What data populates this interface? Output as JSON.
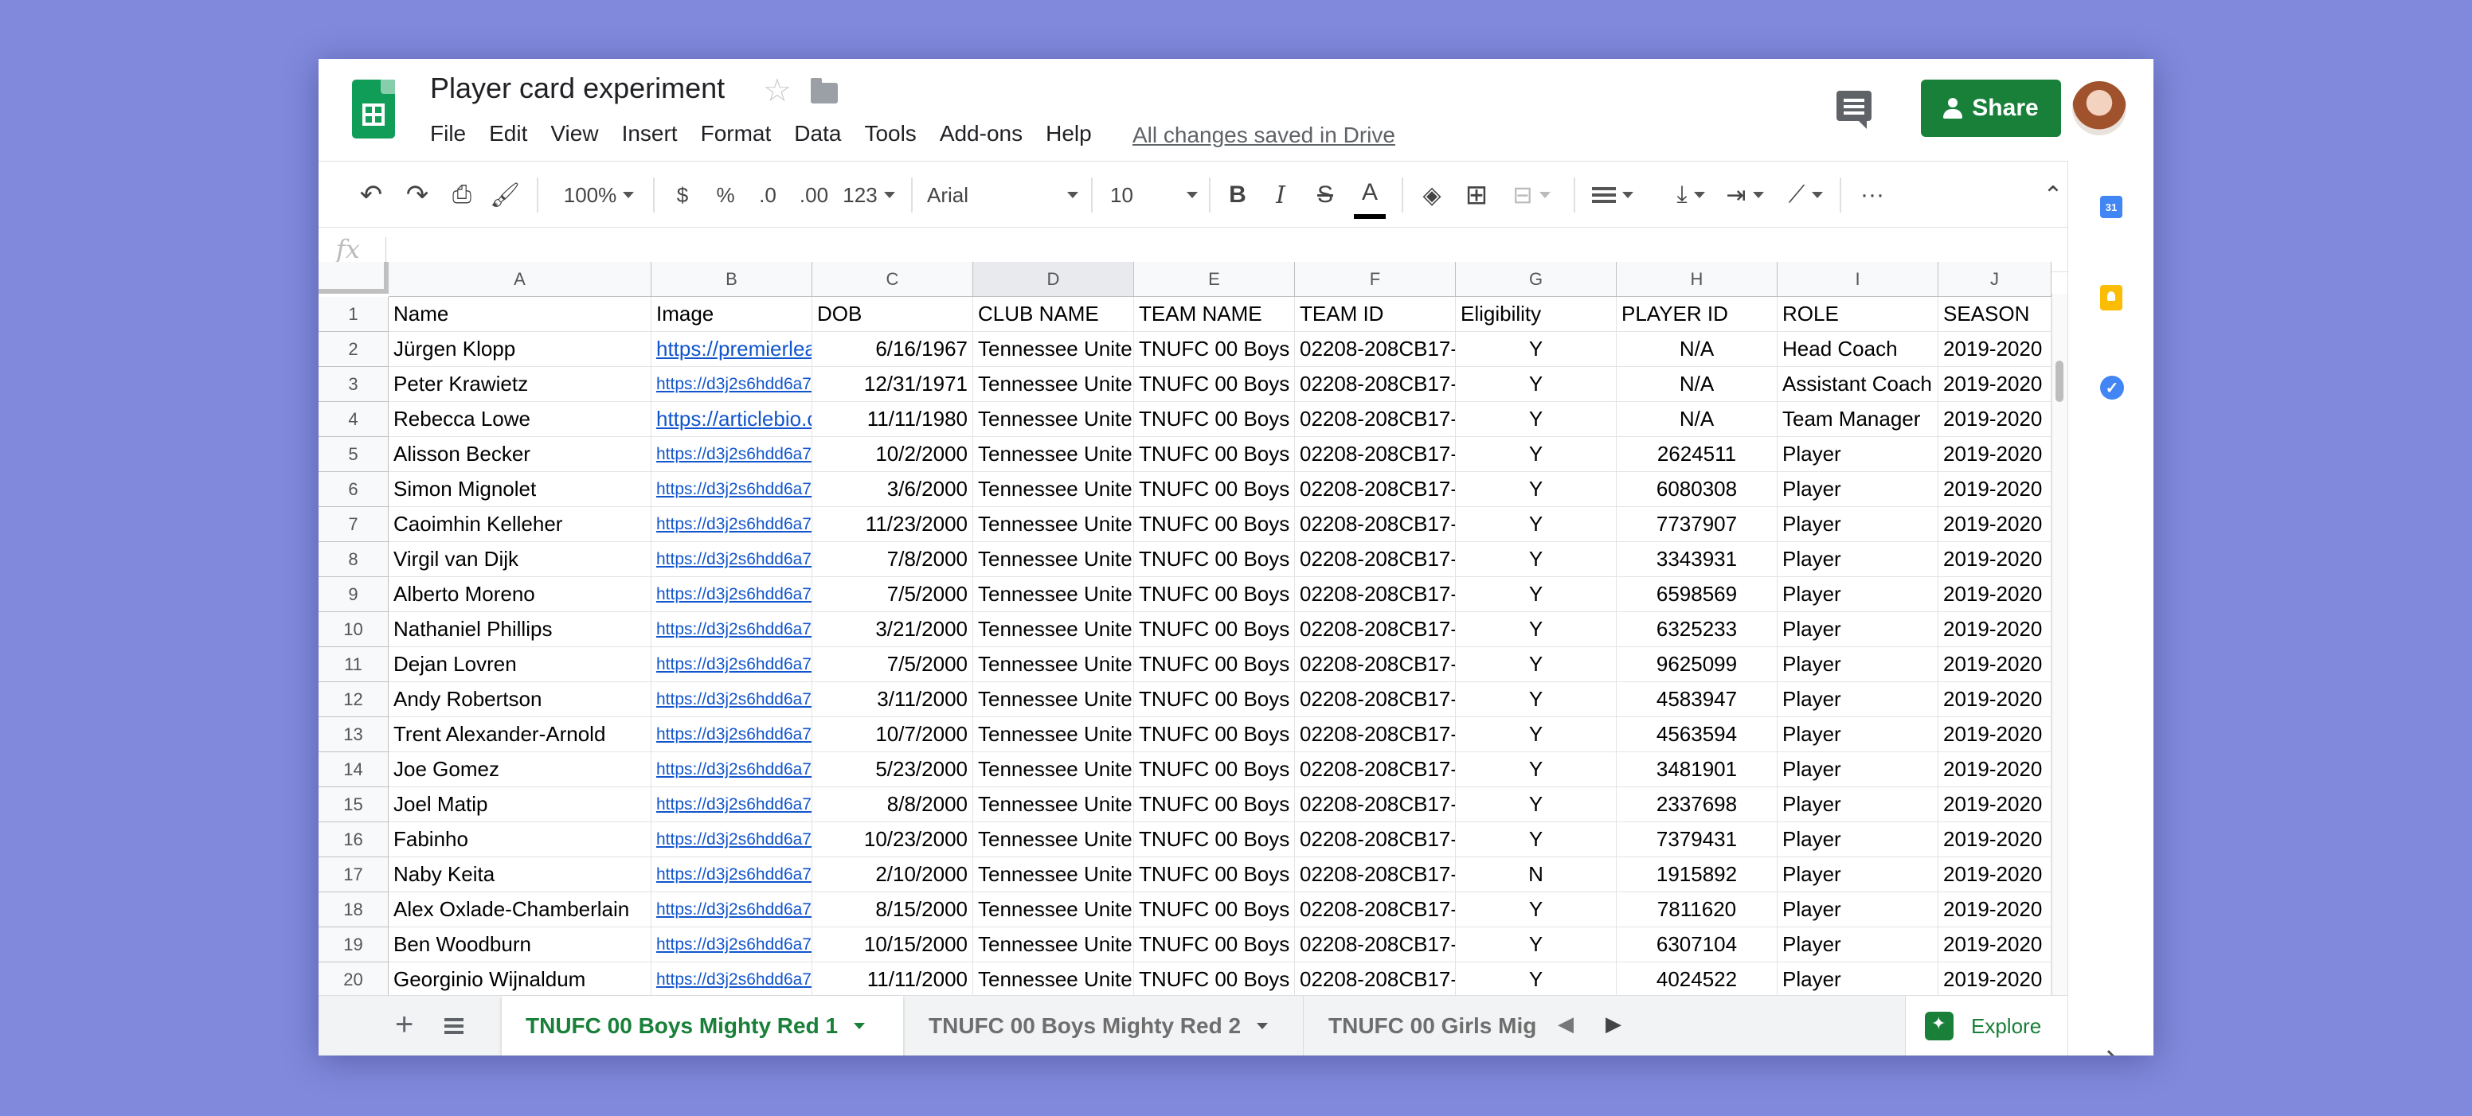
{
  "app": {
    "doc_title": "Player card experiment",
    "menus": [
      "File",
      "Edit",
      "View",
      "Insert",
      "Format",
      "Data",
      "Tools",
      "Add-ons",
      "Help"
    ],
    "saved_status": "All changes saved in Drive",
    "share_label": "Share"
  },
  "toolbar": {
    "zoom": "100%",
    "currency": "$",
    "percent": "%",
    "decrease_decimal": ".0",
    "increase_decimal": ".00",
    "more_formats": "123",
    "font": "Arial",
    "font_size": "10",
    "bold": "B",
    "italic": "I",
    "strike": "S",
    "text_color": "A",
    "more": "···"
  },
  "formula": {
    "fx": "fx",
    "value": ""
  },
  "grid": {
    "columns": [
      "A",
      "B",
      "C",
      "D",
      "E",
      "F",
      "G",
      "H",
      "I",
      "J"
    ],
    "row_numbers": [
      "1",
      "2",
      "3",
      "4",
      "5",
      "6",
      "7",
      "8",
      "9",
      "10",
      "11",
      "12",
      "13",
      "14",
      "15",
      "16",
      "17",
      "18",
      "19",
      "20"
    ],
    "header": [
      "Name",
      "Image",
      "DOB",
      "CLUB NAME",
      "TEAM NAME",
      "TEAM ID",
      "Eligibility",
      "PLAYER ID",
      "ROLE",
      "SEASON"
    ],
    "rows": [
      [
        "Jürgen Klopp",
        "https://premierlea",
        "6/16/1967",
        "Tennessee Unite",
        "TNUFC 00 Boys",
        "02208-208CB17-",
        "Y",
        "N/A",
        "Head Coach",
        "2019-2020"
      ],
      [
        "Peter Krawietz",
        "https://d3j2s6hdd6a7",
        "12/31/1971",
        "Tennessee Unite",
        "TNUFC 00 Boys",
        "02208-208CB17-",
        "Y",
        "N/A",
        "Assistant Coach",
        "2019-2020"
      ],
      [
        "Rebecca Lowe",
        "https://articlebio.c",
        "11/11/1980",
        "Tennessee Unite",
        "TNUFC 00 Boys",
        "02208-208CB17-",
        "Y",
        "N/A",
        "Team Manager",
        "2019-2020"
      ],
      [
        "Alisson Becker",
        "https://d3j2s6hdd6a7",
        "10/2/2000",
        "Tennessee Unite",
        "TNUFC 00 Boys",
        "02208-208CB17-",
        "Y",
        "2624511",
        "Player",
        "2019-2020"
      ],
      [
        "Simon Mignolet",
        "https://d3j2s6hdd6a7",
        "3/6/2000",
        "Tennessee Unite",
        "TNUFC 00 Boys",
        "02208-208CB17-",
        "Y",
        "6080308",
        "Player",
        "2019-2020"
      ],
      [
        "Caoimhin Kelleher",
        "https://d3j2s6hdd6a7",
        "11/23/2000",
        "Tennessee Unite",
        "TNUFC 00 Boys",
        "02208-208CB17-",
        "Y",
        "7737907",
        "Player",
        "2019-2020"
      ],
      [
        "Virgil van Dijk",
        "https://d3j2s6hdd6a7",
        "7/8/2000",
        "Tennessee Unite",
        "TNUFC 00 Boys",
        "02208-208CB17-",
        "Y",
        "3343931",
        "Player",
        "2019-2020"
      ],
      [
        "Alberto Moreno",
        "https://d3j2s6hdd6a7",
        "7/5/2000",
        "Tennessee Unite",
        "TNUFC 00 Boys",
        "02208-208CB17-",
        "Y",
        "6598569",
        "Player",
        "2019-2020"
      ],
      [
        "Nathaniel Phillips",
        "https://d3j2s6hdd6a7",
        "3/21/2000",
        "Tennessee Unite",
        "TNUFC 00 Boys",
        "02208-208CB17-",
        "Y",
        "6325233",
        "Player",
        "2019-2020"
      ],
      [
        "Dejan Lovren",
        "https://d3j2s6hdd6a7",
        "7/5/2000",
        "Tennessee Unite",
        "TNUFC 00 Boys",
        "02208-208CB17-",
        "Y",
        "9625099",
        "Player",
        "2019-2020"
      ],
      [
        "Andy Robertson",
        "https://d3j2s6hdd6a7",
        "3/11/2000",
        "Tennessee Unite",
        "TNUFC 00 Boys",
        "02208-208CB17-",
        "Y",
        "4583947",
        "Player",
        "2019-2020"
      ],
      [
        "Trent Alexander-Arnold",
        "https://d3j2s6hdd6a7",
        "10/7/2000",
        "Tennessee Unite",
        "TNUFC 00 Boys",
        "02208-208CB17-",
        "Y",
        "4563594",
        "Player",
        "2019-2020"
      ],
      [
        "Joe Gomez",
        "https://d3j2s6hdd6a7",
        "5/23/2000",
        "Tennessee Unite",
        "TNUFC 00 Boys",
        "02208-208CB17-",
        "Y",
        "3481901",
        "Player",
        "2019-2020"
      ],
      [
        "Joel Matip",
        "https://d3j2s6hdd6a7",
        "8/8/2000",
        "Tennessee Unite",
        "TNUFC 00 Boys",
        "02208-208CB17-",
        "Y",
        "2337698",
        "Player",
        "2019-2020"
      ],
      [
        "Fabinho",
        "https://d3j2s6hdd6a7",
        "10/23/2000",
        "Tennessee Unite",
        "TNUFC 00 Boys",
        "02208-208CB17-",
        "Y",
        "7379431",
        "Player",
        "2019-2020"
      ],
      [
        "Naby Keita",
        "https://d3j2s6hdd6a7",
        "2/10/2000",
        "Tennessee Unite",
        "TNUFC 00 Boys",
        "02208-208CB17-",
        "N",
        "1915892",
        "Player",
        "2019-2020"
      ],
      [
        "Alex Oxlade-Chamberlain",
        "https://d3j2s6hdd6a7",
        "8/15/2000",
        "Tennessee Unite",
        "TNUFC 00 Boys",
        "02208-208CB17-",
        "Y",
        "7811620",
        "Player",
        "2019-2020"
      ],
      [
        "Ben Woodburn",
        "https://d3j2s6hdd6a7",
        "10/15/2000",
        "Tennessee Unite",
        "TNUFC 00 Boys",
        "02208-208CB17-",
        "Y",
        "6307104",
        "Player",
        "2019-2020"
      ],
      [
        "Georginio Wijnaldum",
        "https://d3j2s6hdd6a7",
        "11/11/2000",
        "Tennessee Unite",
        "TNUFC 00 Boys",
        "02208-208CB17-",
        "Y",
        "4024522",
        "Player",
        "2019-2020"
      ]
    ]
  },
  "sheets": {
    "tabs": [
      "TNUFC 00 Boys Mighty Red 1",
      "TNUFC 00 Boys Mighty Red 2",
      "TNUFC 00 Girls Mig"
    ],
    "active_index": 0,
    "explore_label": "Explore"
  },
  "side_panel": {
    "calendar_day": "31"
  },
  "colors": {
    "brand_green": "#188038",
    "background": "#8089dc",
    "link": "#1155cc"
  },
  "icons": [
    "undo-icon",
    "redo-icon",
    "print-icon",
    "paint-format-icon",
    "bold-icon",
    "italic-icon",
    "strikethrough-icon",
    "text-color-icon",
    "fill-color-icon",
    "borders-icon",
    "merge-cells-icon",
    "align-icon",
    "valign-icon",
    "text-wrap-icon",
    "text-rotation-icon",
    "more-icon",
    "collapse-icon",
    "comment-icon",
    "calendar-icon",
    "keep-icon",
    "tasks-icon",
    "explore-icon"
  ]
}
